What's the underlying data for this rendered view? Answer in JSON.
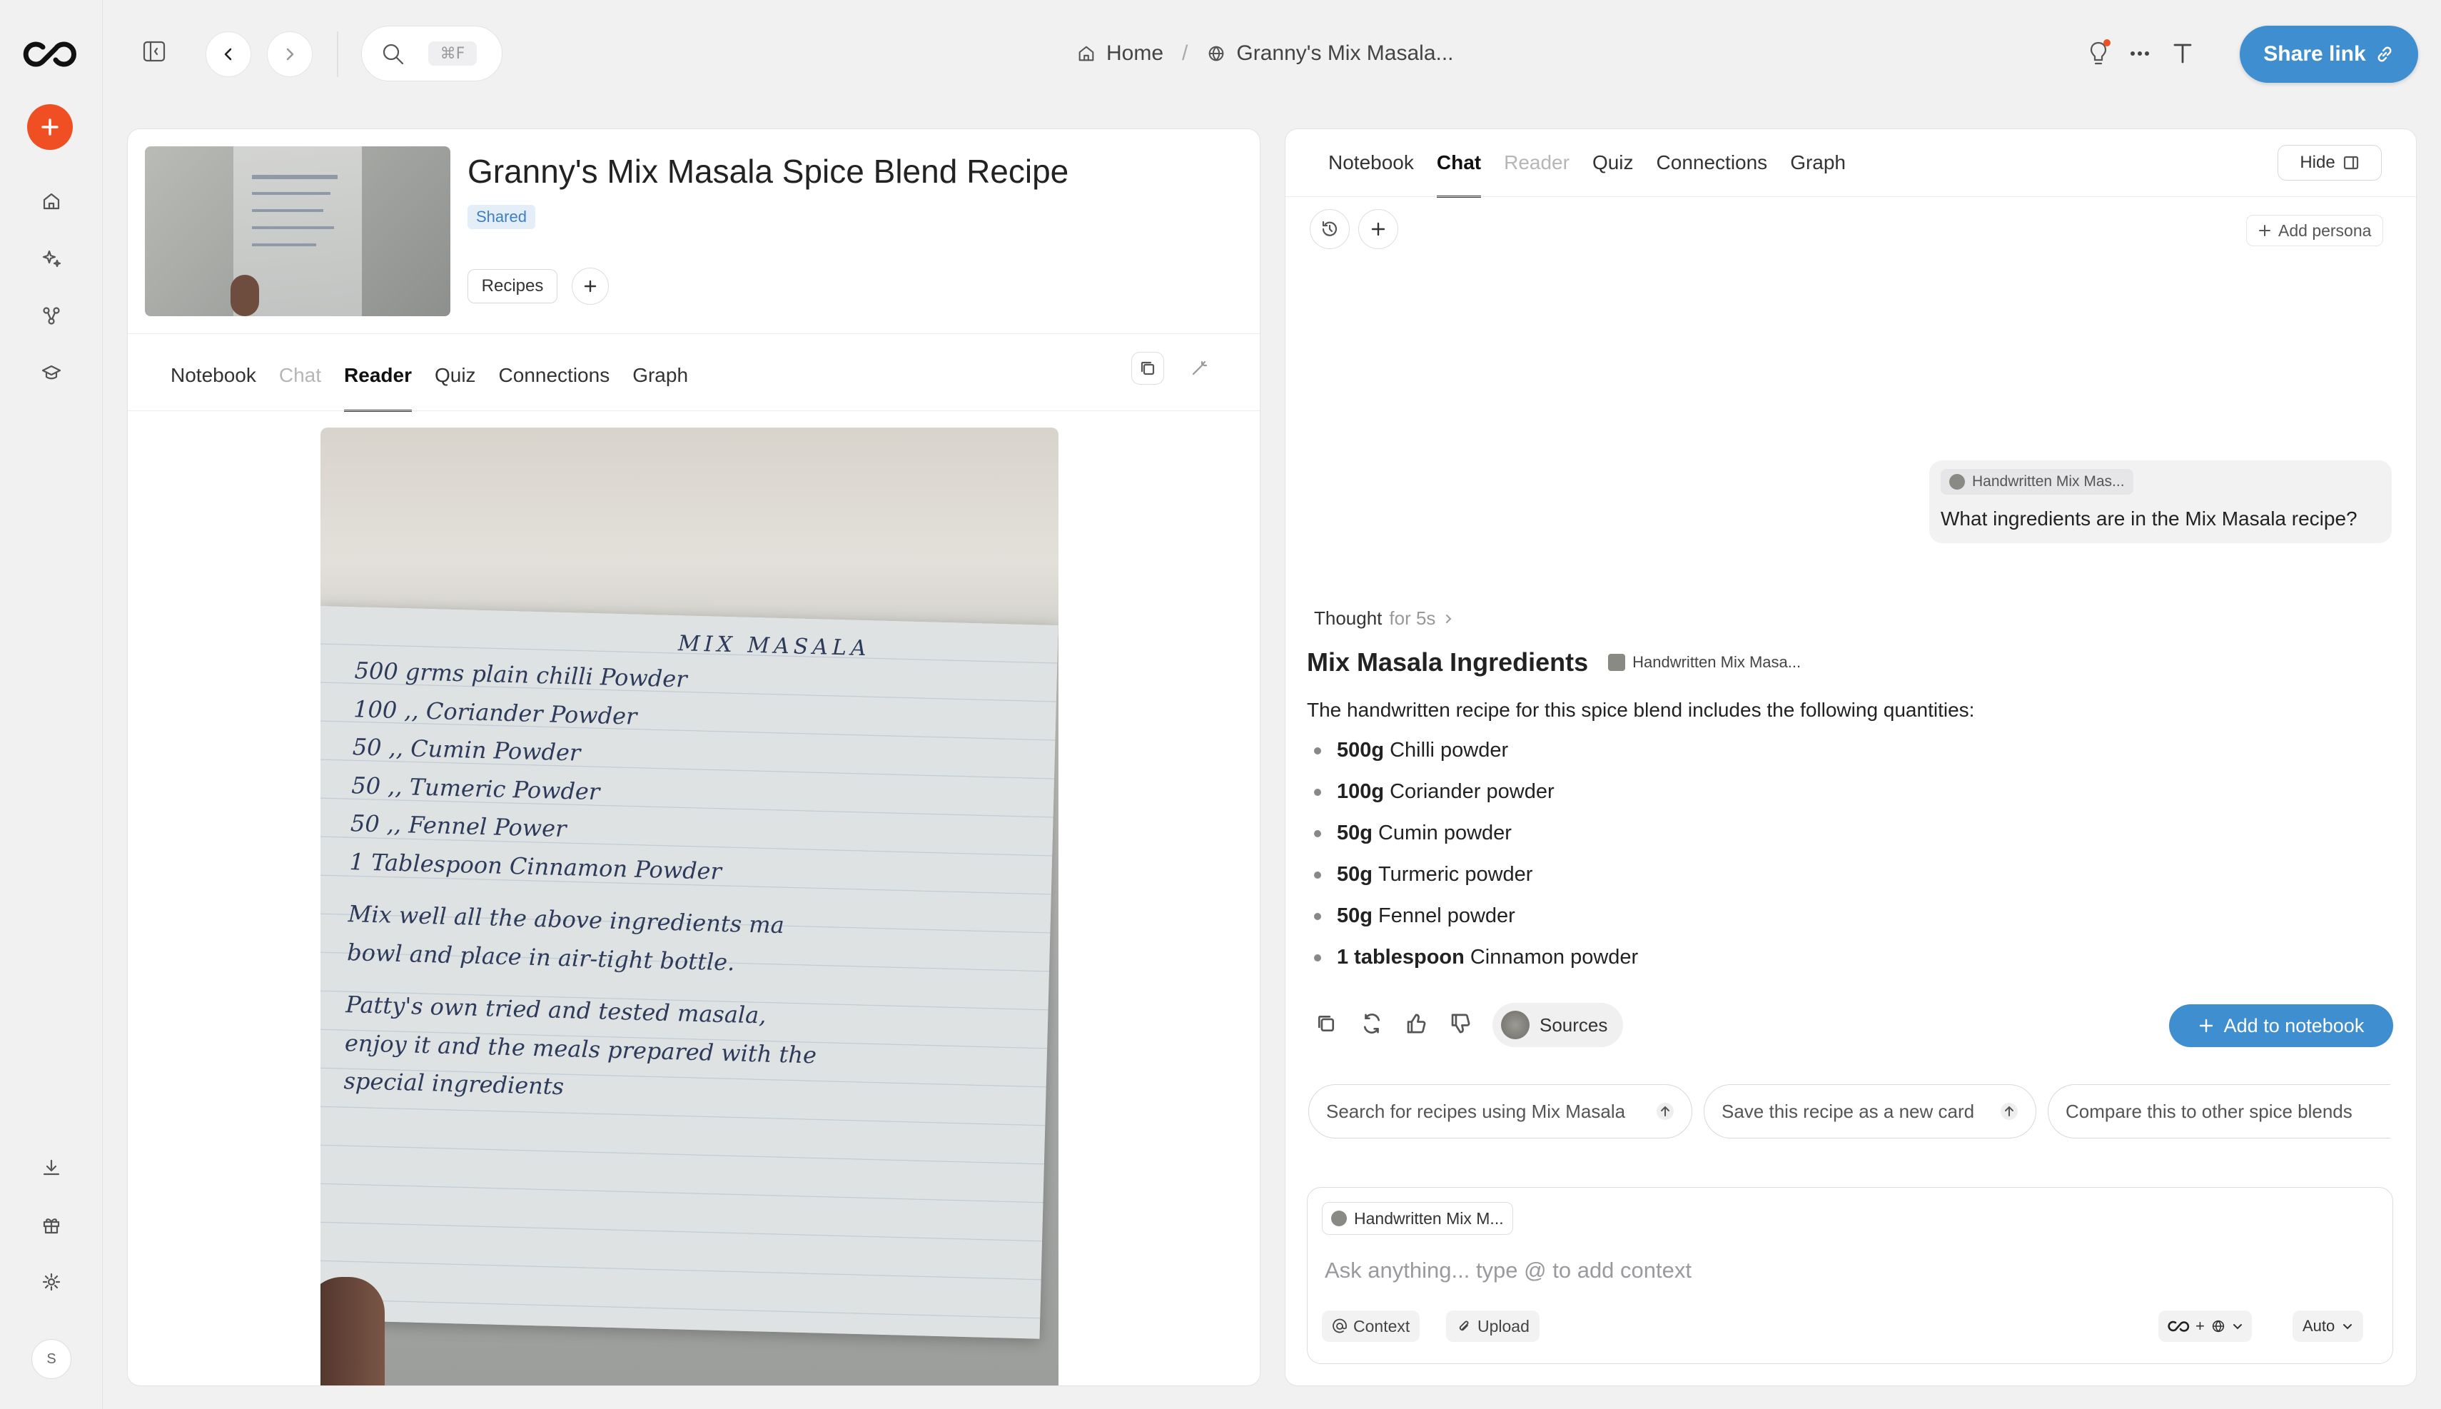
{
  "app": {
    "accent": "#f04e23",
    "brand": "#3f8ed0"
  },
  "topbar": {
    "search_shortcut": "⌘F",
    "breadcrumb": {
      "home": "Home",
      "current": "Granny's Mix Masala..."
    },
    "share_label": "Share link"
  },
  "rail": {
    "avatar_initial": "S"
  },
  "card": {
    "title": "Granny's Mix Masala Spice Blend Recipe",
    "badge": "Shared",
    "tag": "Recipes"
  },
  "left_tabs": [
    {
      "label": "Notebook"
    },
    {
      "label": "Chat"
    },
    {
      "label": "Reader"
    },
    {
      "label": "Quiz"
    },
    {
      "label": "Connections"
    },
    {
      "label": "Graph"
    }
  ],
  "right_tabs": [
    {
      "label": "Notebook"
    },
    {
      "label": "Chat"
    },
    {
      "label": "Reader"
    },
    {
      "label": "Quiz"
    },
    {
      "label": "Connections"
    },
    {
      "label": "Graph"
    }
  ],
  "right_panel": {
    "hide_label": "Hide",
    "add_persona": "Add persona"
  },
  "handwritten": {
    "heading": "MIX MASALA",
    "lines": [
      "500 grms plain chilli Powder",
      "100  ,,  Coriander Powder",
      "50  ,,  Cumin Powder",
      "50  ,,  Tumeric Powder",
      "50  ,,  Fennel Power",
      "1  Tablespoon Cinnamon Powder",
      "Mix well all the above ingredients ma",
      "bowl and place in air-tight bottle.",
      "Patty's own tried and tested masala,",
      "enjoy it and the meals prepared with the",
      "special ingredients"
    ]
  },
  "chat": {
    "user_source": "Handwritten Mix Mas...",
    "user_message": "What ingredients are in the Mix Masala recipe?",
    "thought_label": "Thought",
    "thought_time": "for 5s",
    "answer_title": "Mix Masala Ingredients",
    "answer_source": "Handwritten Mix Masa...",
    "answer_intro": "The handwritten recipe for this spice blend includes the following quantities:",
    "ingredients": [
      {
        "qty": "500g",
        "name": "Chilli powder"
      },
      {
        "qty": "100g",
        "name": "Coriander powder"
      },
      {
        "qty": "50g",
        "name": "Cumin powder"
      },
      {
        "qty": "50g",
        "name": "Turmeric powder"
      },
      {
        "qty": "50g",
        "name": "Fennel powder"
      },
      {
        "qty": "1 tablespoon",
        "name": "Cinnamon powder"
      }
    ],
    "sources_label": "Sources",
    "add_to_notebook": "Add to notebook",
    "suggestions": [
      "Search for recipes using Mix Masala",
      "Save this recipe as a new card",
      "Compare this to other spice blends"
    ]
  },
  "composer": {
    "context_chip": "Handwritten Mix M...",
    "placeholder": "Ask anything... type @ to add context",
    "context_label": "Context",
    "upload_label": "Upload",
    "model_label": "Auto"
  }
}
